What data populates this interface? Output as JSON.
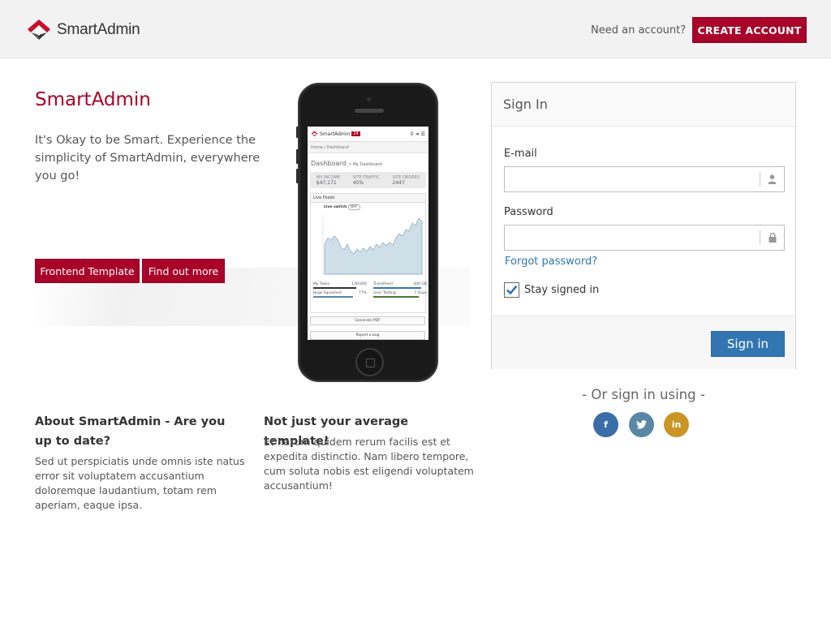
{
  "header": {
    "logo_text": "SmartAdmin",
    "need_account": "Need an account?",
    "create_account": "CREATE ACCOUNT"
  },
  "hero": {
    "title": "SmartAdmin",
    "text": "It's Okay to be Smart. Experience the simplicity of SmartAdmin, everywhere you go!",
    "btn_frontend": "Frontend Template",
    "btn_findout": "Find out more"
  },
  "phone_screen": {
    "logo_text": "SmartAdmin",
    "badge": "24",
    "breadcrumb": "Home / Dashboard",
    "dashboard": "Dashboard",
    "dashboard_sub": "> My Dashboard",
    "stats": [
      {
        "label": "MY INCOME",
        "value": "$47,171"
      },
      {
        "label": "SITE TRAFFIC",
        "value": "45%"
      },
      {
        "label": "SITE ORDERS",
        "value": "2447"
      }
    ],
    "feeds": "Live Feeds",
    "live_switch": "Live switch",
    "switch_state": "OFF",
    "bars": [
      {
        "label": "My Tasks",
        "value": "130/200"
      },
      {
        "label": "Transfered",
        "value": "440 GB"
      },
      {
        "label": "Bugs Squashed",
        "value": "77%"
      },
      {
        "label": "User Testing",
        "value": "7 Days"
      }
    ],
    "generate": "Generate PDF",
    "report": "Report a bug"
  },
  "columns": {
    "col1_title": "About SmartAdmin - Are you up to date?",
    "col1_text": "Sed ut perspiciatis unde omnis iste natus error sit voluptatem accusantium doloremque laudantium, totam rem aperiam, eaque ipsa.",
    "col2_title": "Not just your average template!",
    "col2_text": "Et harum quidem rerum facilis est et expedita distinctio. Nam libero tempore, cum soluta nobis est eligendi voluptatem accusantium!"
  },
  "signin": {
    "title": "Sign In",
    "email_label": "E-mail",
    "email_value": "",
    "password_label": "Password",
    "password_value": "",
    "forgot": "Forgot password?",
    "stay_signed": "Stay signed in",
    "stay_checked": true,
    "submit": "Sign in",
    "or_sign": "- Or sign in using -"
  },
  "social": {
    "facebook": "f",
    "twitter": "t",
    "linkedin": "in"
  },
  "colors": {
    "brand_red": "#a90329",
    "primary_blue": "#3276b1"
  },
  "icons": [
    "smartadmin-logo",
    "user-icon",
    "lock-icon",
    "check-icon",
    "facebook-icon",
    "twitter-icon",
    "linkedin-icon"
  ]
}
